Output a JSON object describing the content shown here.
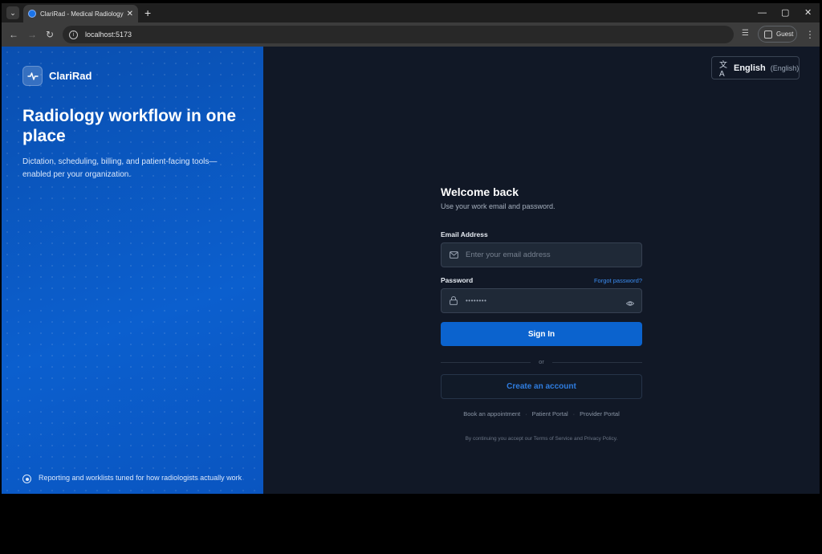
{
  "browser": {
    "tab_title": "ClariRad - Medical Radiology R",
    "url": "localhost:5173",
    "profile_label": "Guest"
  },
  "brand": {
    "name": "ClariRad",
    "accent": "#0b63ce"
  },
  "hero": {
    "title": "Radiology workflow in one place",
    "subtitle": "Dictation, scheduling, billing, and patient-facing tools—enabled per your organization.",
    "footer": "Reporting and worklists tuned for how radiologists actually work"
  },
  "language": {
    "name": "English",
    "native": "(English)"
  },
  "login": {
    "title": "Welcome back",
    "subtitle": "Use your work email and password.",
    "email_label": "Email Address",
    "email_placeholder": "Enter your email address",
    "password_label": "Password",
    "forgot_link": "Forgot password?",
    "password_mask": "••••••••",
    "signin_label": "Sign In",
    "divider_text": "or",
    "create_account_label": "Create an account",
    "links": [
      "Book an appointment",
      "Patient Portal",
      "Provider Portal"
    ],
    "legal": "By continuing you accept our Terms of Service and Privacy Policy."
  },
  "icons": {
    "logo": "pulse-icon",
    "language": "translate-icon",
    "email": "mail-icon",
    "password": "lock-icon",
    "reveal": "eye-icon",
    "footer": "target-icon"
  }
}
